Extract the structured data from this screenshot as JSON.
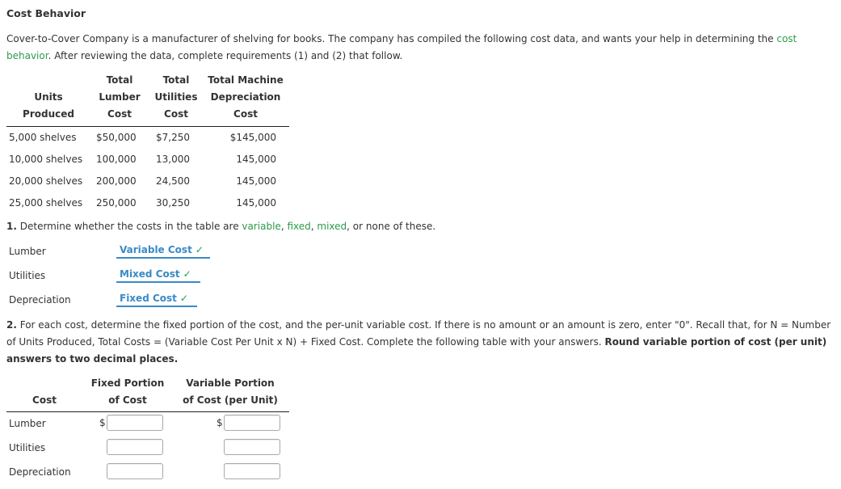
{
  "title": "Cost Behavior",
  "intro": {
    "part1": "Cover-to-Cover Company is a manufacturer of shelving for books. The company has compiled the following cost data, and wants your help in determining the ",
    "link": "cost behavior",
    "part2": ". After reviewing the data, complete requirements (1) and (2) that follow."
  },
  "cost_table": {
    "headers": [
      [
        "",
        "Units",
        "Produced"
      ],
      [
        "Total",
        "Lumber",
        "Cost"
      ],
      [
        "Total",
        "Utilities",
        "Cost"
      ],
      [
        "Total Machine",
        "Depreciation",
        "Cost"
      ]
    ],
    "rows": [
      [
        "5,000 shelves",
        "$50,000",
        "$7,250",
        "$145,000"
      ],
      [
        "10,000 shelves",
        "100,000",
        "13,000",
        "145,000"
      ],
      [
        "20,000 shelves",
        "200,000",
        "24,500",
        "145,000"
      ],
      [
        "25,000 shelves",
        "250,000",
        "30,250",
        "145,000"
      ]
    ]
  },
  "q1": {
    "number": "1.",
    "text_a": " Determine whether the costs in the table are ",
    "variable": "variable",
    "comma1": ", ",
    "fixed": "fixed",
    "comma2": ", ",
    "mixed": "mixed",
    "text_b": ", or none of these.",
    "items": [
      {
        "label": "Lumber",
        "answer": "Variable Cost",
        "status": "correct"
      },
      {
        "label": "Utilities",
        "answer": "Mixed Cost",
        "status": "correct"
      },
      {
        "label": "Depreciation",
        "answer": "Fixed Cost",
        "status": "correct"
      }
    ],
    "check_glyph": "✓"
  },
  "q2": {
    "number": "2.",
    "text_a": " For each cost, determine the fixed portion of the cost, and the per-unit variable cost. If there is no amount or an amount is zero, enter \"0\". Recall that, for N = Number of Units Produced, Total Costs = (Variable Cost Per Unit x N) + Fixed Cost. Complete the following table with your answers. ",
    "bold_text": "Round variable portion of cost (per unit) answers to two decimal places.",
    "headers": {
      "cost": "Cost",
      "fixed_1": "Fixed Portion",
      "fixed_2": "of Cost",
      "variable_1": "Variable Portion",
      "variable_2": "of Cost (per Unit)"
    },
    "currency": "$",
    "rows": [
      {
        "label": "Lumber",
        "fixed_value": "",
        "variable_value": ""
      },
      {
        "label": "Utilities",
        "fixed_value": "",
        "variable_value": ""
      },
      {
        "label": "Depreciation",
        "fixed_value": "",
        "variable_value": ""
      }
    ]
  }
}
